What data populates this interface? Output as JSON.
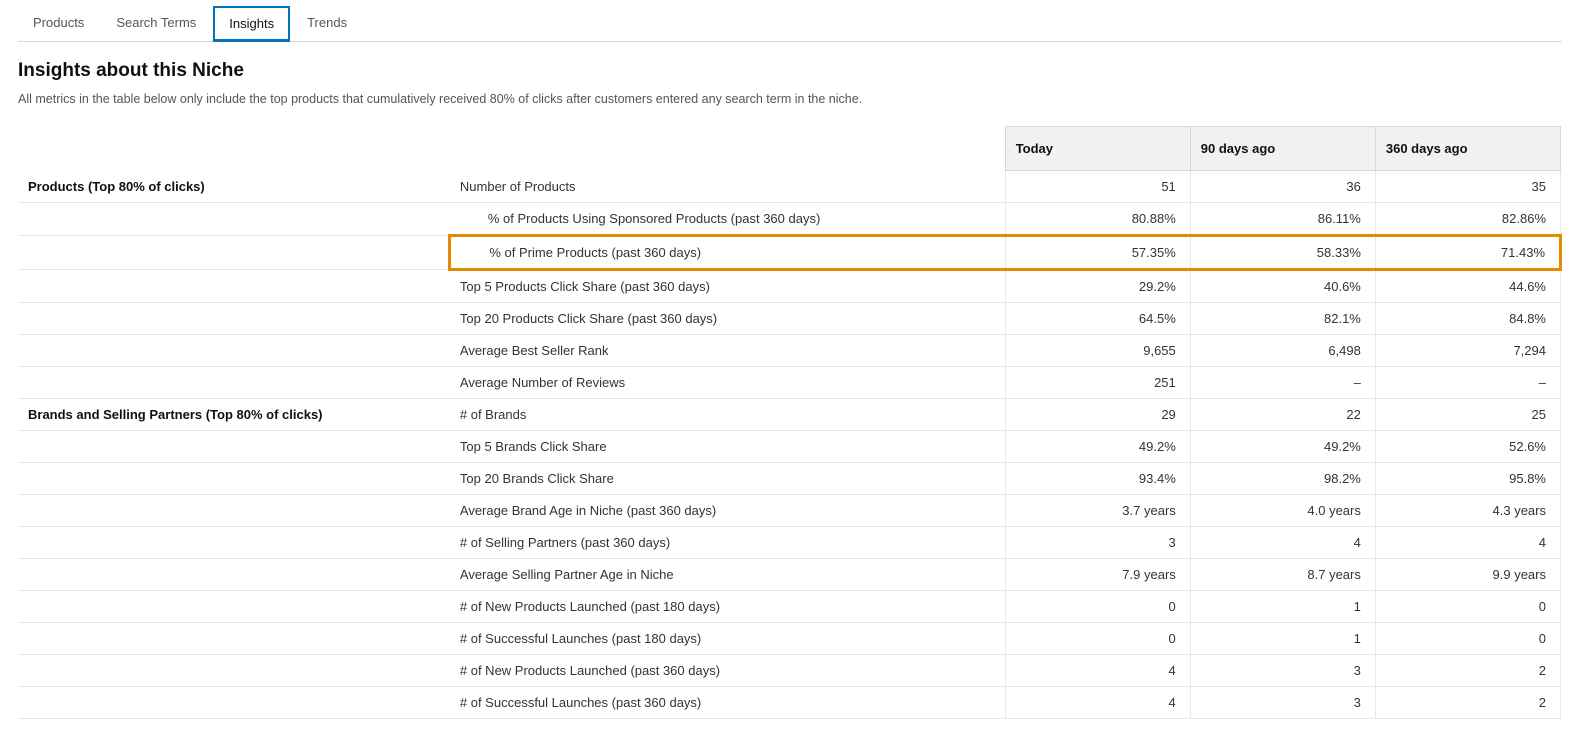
{
  "tabs": [
    {
      "label": "Products",
      "active": false
    },
    {
      "label": "Search Terms",
      "active": false
    },
    {
      "label": "Insights",
      "active": true
    },
    {
      "label": "Trends",
      "active": false
    }
  ],
  "title": "Insights about this Niche",
  "description": "All metrics in the table below only include the top products that cumulatively received 80% of clicks after customers entered any search term in the niche.",
  "columns": [
    "Today",
    "90 days ago",
    "360 days ago"
  ],
  "sections": [
    {
      "group": "Products (Top 80% of clicks)",
      "rows": [
        {
          "label": "Number of Products",
          "indent": false,
          "highlight": false,
          "values": [
            "51",
            "36",
            "35"
          ]
        },
        {
          "label": "% of Products Using Sponsored Products (past 360 days)",
          "indent": true,
          "highlight": false,
          "values": [
            "80.88%",
            "86.11%",
            "82.86%"
          ]
        },
        {
          "label": "% of Prime Products (past 360 days)",
          "indent": true,
          "highlight": true,
          "values": [
            "57.35%",
            "58.33%",
            "71.43%"
          ]
        },
        {
          "label": "Top 5 Products Click Share (past 360 days)",
          "indent": false,
          "highlight": false,
          "values": [
            "29.2%",
            "40.6%",
            "44.6%"
          ]
        },
        {
          "label": "Top 20 Products Click Share (past 360 days)",
          "indent": false,
          "highlight": false,
          "values": [
            "64.5%",
            "82.1%",
            "84.8%"
          ]
        },
        {
          "label": "Average Best Seller Rank",
          "indent": false,
          "highlight": false,
          "values": [
            "9,655",
            "6,498",
            "7,294"
          ]
        },
        {
          "label": "Average Number of Reviews",
          "indent": false,
          "highlight": false,
          "values": [
            "251",
            "–",
            "–"
          ]
        }
      ]
    },
    {
      "group": "Brands and Selling Partners (Top 80% of clicks)",
      "rows": [
        {
          "label": "# of Brands",
          "indent": false,
          "highlight": false,
          "values": [
            "29",
            "22",
            "25"
          ]
        },
        {
          "label": "Top 5 Brands Click Share",
          "indent": false,
          "highlight": false,
          "values": [
            "49.2%",
            "49.2%",
            "52.6%"
          ]
        },
        {
          "label": "Top 20 Brands Click Share",
          "indent": false,
          "highlight": false,
          "values": [
            "93.4%",
            "98.2%",
            "95.8%"
          ]
        },
        {
          "label": "Average Brand Age in Niche (past 360 days)",
          "indent": false,
          "highlight": false,
          "values": [
            "3.7 years",
            "4.0 years",
            "4.3 years"
          ]
        },
        {
          "label": "# of Selling Partners (past 360 days)",
          "indent": false,
          "highlight": false,
          "values": [
            "3",
            "4",
            "4"
          ]
        },
        {
          "label": "Average Selling Partner Age in Niche",
          "indent": false,
          "highlight": false,
          "values": [
            "7.9 years",
            "8.7 years",
            "9.9 years"
          ]
        },
        {
          "label": "# of New Products Launched (past 180 days)",
          "indent": false,
          "highlight": false,
          "values": [
            "0",
            "1",
            "0"
          ]
        },
        {
          "label": "# of Successful Launches (past 180 days)",
          "indent": false,
          "highlight": false,
          "values": [
            "0",
            "1",
            "0"
          ]
        },
        {
          "label": "# of New Products Launched (past 360 days)",
          "indent": false,
          "highlight": false,
          "values": [
            "4",
            "3",
            "2"
          ]
        },
        {
          "label": "# of Successful Launches (past 360 days)",
          "indent": false,
          "highlight": false,
          "values": [
            "4",
            "3",
            "2"
          ]
        }
      ]
    }
  ]
}
